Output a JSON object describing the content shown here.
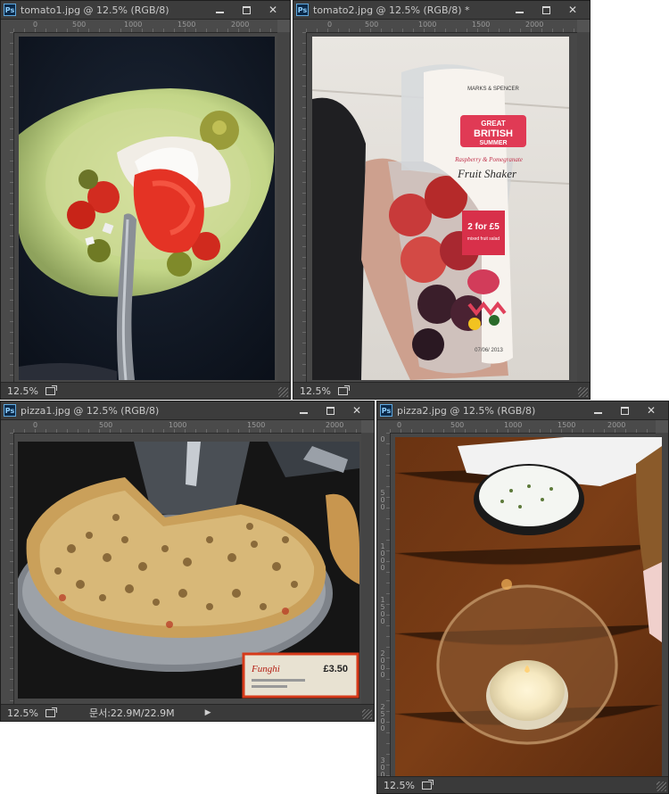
{
  "windows": [
    {
      "title": "tomato1.jpg @ 12.5% (RGB/8)",
      "zoom": "12.5%",
      "ruler_h": [
        "0",
        "500",
        "1000",
        "1500",
        "2000"
      ],
      "ps": "Ps"
    },
    {
      "title": "tomato2.jpg @ 12.5% (RGB/8) *",
      "zoom": "12.5%",
      "ruler_h": [
        "0",
        "500",
        "1000",
        "1500",
        "2000"
      ],
      "ps": "Ps",
      "package": {
        "brand": "MARKS & SPENCER",
        "great": "GREAT",
        "british": "BRITISH",
        "summer": "SUMMER",
        "flavour": "Raspberry & Pomegranate",
        "product": "Fruit Shaker",
        "offer_main": "2 for £5",
        "offer_sub": "mixed fruit salad",
        "date": "07/06/ 2013"
      }
    },
    {
      "title": "pizza1.jpg @ 12.5% (RGB/8)",
      "zoom": "12.5%",
      "docinfo": "문서:22.9M/22.9M",
      "ruler_h": [
        "0",
        "500",
        "1000",
        "1500",
        "2000"
      ],
      "ps": "Ps",
      "price_tag": {
        "name": "Funghi",
        "price": "£3.50"
      }
    },
    {
      "title": "pizza2.jpg @ 12.5% (RGB/8)",
      "zoom": "12.5%",
      "ruler_h": [
        "0",
        "500",
        "1000",
        "1500",
        "2000"
      ],
      "ruler_v": [
        "0",
        "500",
        "1000",
        "1500",
        "2000",
        "2500",
        "3000"
      ],
      "ps": "Ps"
    }
  ],
  "icons": {
    "minimize": "minimize-icon",
    "maximize": "maximize-icon",
    "close": "close-icon",
    "share": "share-icon",
    "arrow": "arrow-right-icon"
  },
  "colors": {
    "panel": "#535353",
    "titlebar": "#3c3c3c",
    "ps_blue": "#5fa9e0"
  }
}
